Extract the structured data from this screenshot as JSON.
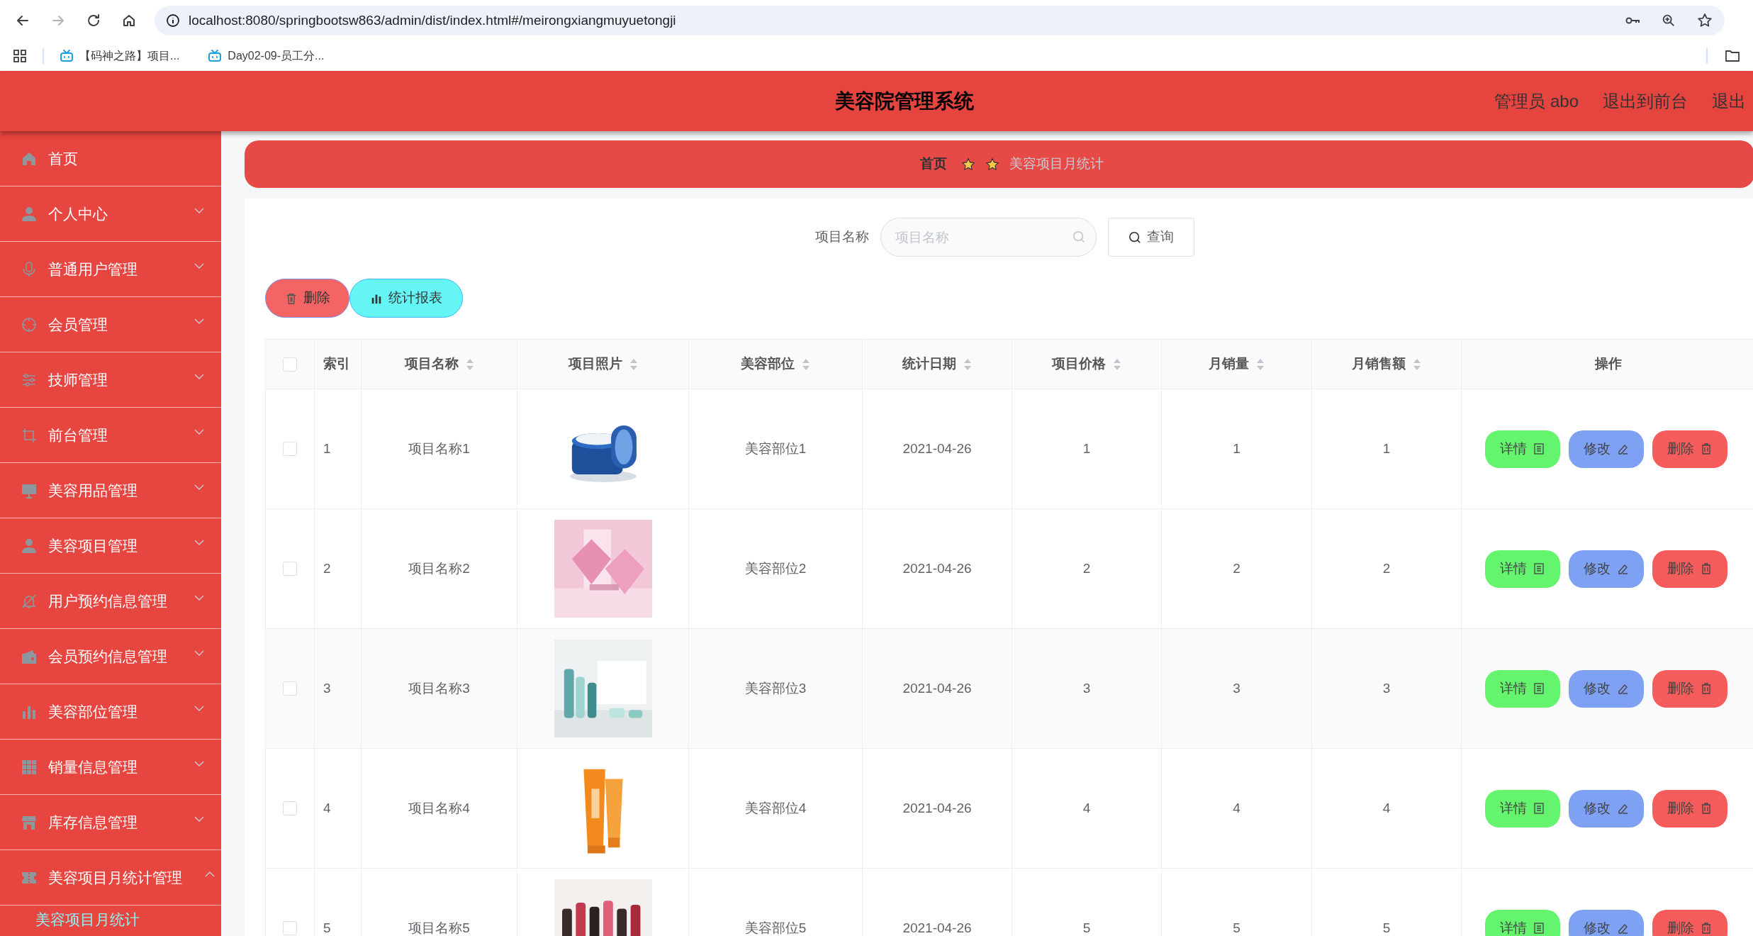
{
  "browser": {
    "url": "localhost:8080/springbootsw863/admin/dist/index.html#/meirongxiangmuyuetongji",
    "nav": [
      {
        "kind": "back",
        "disabled": false
      },
      {
        "kind": "forward",
        "disabled": true
      },
      {
        "kind": "reload",
        "disabled": false
      },
      {
        "kind": "home",
        "disabled": false
      }
    ],
    "bookmarks": [
      "【码神之路】项目...",
      "Day02-09-员工分..."
    ]
  },
  "header": {
    "title": "美容院管理系统",
    "links": [
      "管理员 abo",
      "退出到前台",
      "退出"
    ]
  },
  "sidebar": {
    "items": [
      {
        "label": "首页",
        "kind": "link"
      },
      {
        "label": "个人中心",
        "kind": "menu",
        "expanded": false
      },
      {
        "label": "普通用户管理",
        "kind": "menu",
        "expanded": false
      },
      {
        "label": "会员管理",
        "kind": "menu",
        "expanded": false
      },
      {
        "label": "技师管理",
        "kind": "menu",
        "expanded": false
      },
      {
        "label": "前台管理",
        "kind": "menu",
        "expanded": false
      },
      {
        "label": "美容用品管理",
        "kind": "menu",
        "expanded": false
      },
      {
        "label": "美容项目管理",
        "kind": "menu",
        "expanded": false
      },
      {
        "label": "用户预约信息管理",
        "kind": "menu",
        "expanded": false
      },
      {
        "label": "会员预约信息管理",
        "kind": "menu",
        "expanded": false
      },
      {
        "label": "美容部位管理",
        "kind": "menu",
        "expanded": false
      },
      {
        "label": "销量信息管理",
        "kind": "menu",
        "expanded": false
      },
      {
        "label": "库存信息管理",
        "kind": "menu",
        "expanded": false
      },
      {
        "label": "美容项目月统计管理",
        "kind": "menu",
        "expanded": true,
        "children": [
          {
            "label": "美容项目月统计",
            "selected": true
          }
        ]
      }
    ]
  },
  "breadcrumb": [
    "首页",
    "美容项目月统计"
  ],
  "search": {
    "label": "项目名称",
    "placeholder": "项目名称",
    "button": "查询"
  },
  "actions": [
    {
      "label": "删除",
      "kind": "delete"
    },
    {
      "label": "统计报表",
      "kind": "report"
    }
  ],
  "table": {
    "select_all_checked": false,
    "columns": [
      {
        "label": "索引",
        "sortable": false
      },
      {
        "label": "项目名称",
        "sortable": true
      },
      {
        "label": "项目照片",
        "sortable": true
      },
      {
        "label": "美容部位",
        "sortable": true
      },
      {
        "label": "统计日期",
        "sortable": true
      },
      {
        "label": "项目价格",
        "sortable": true
      },
      {
        "label": "月销量",
        "sortable": true
      },
      {
        "label": "月销售额",
        "sortable": true
      },
      {
        "label": "操作",
        "sortable": false
      }
    ],
    "rows": [
      {
        "checked": false,
        "index": "1",
        "name": "项目名称1",
        "photo": {
          "kind": "picture"
        },
        "part": "美容部位1",
        "date": "2021-04-26",
        "price": "1",
        "sales": "1",
        "revenue": "1",
        "actions": [
          {
            "label": "详情",
            "kind": "detail"
          },
          {
            "label": "修改",
            "kind": "edit"
          },
          {
            "label": "删除",
            "kind": "delete"
          }
        ]
      },
      {
        "checked": false,
        "index": "2",
        "name": "项目名称2",
        "photo": {
          "kind": "picture"
        },
        "part": "美容部位2",
        "date": "2021-04-26",
        "price": "2",
        "sales": "2",
        "revenue": "2",
        "actions": [
          {
            "label": "详情",
            "kind": "detail"
          },
          {
            "label": "修改",
            "kind": "edit"
          },
          {
            "label": "删除",
            "kind": "delete"
          }
        ]
      },
      {
        "checked": false,
        "index": "3",
        "name": "项目名称3",
        "photo": {
          "kind": "picture"
        },
        "part": "美容部位3",
        "date": "2021-04-26",
        "price": "3",
        "sales": "3",
        "revenue": "3",
        "actions": [
          {
            "label": "详情",
            "kind": "detail"
          },
          {
            "label": "修改",
            "kind": "edit"
          },
          {
            "label": "删除",
            "kind": "delete"
          }
        ]
      },
      {
        "checked": false,
        "index": "4",
        "name": "项目名称4",
        "photo": {
          "kind": "picture"
        },
        "part": "美容部位4",
        "date": "2021-04-26",
        "price": "4",
        "sales": "4",
        "revenue": "4",
        "actions": [
          {
            "label": "详情",
            "kind": "detail"
          },
          {
            "label": "修改",
            "kind": "edit"
          },
          {
            "label": "删除",
            "kind": "delete"
          }
        ]
      },
      {
        "checked": false,
        "index": "5",
        "name": "项目名称5",
        "photo": {
          "kind": "picture"
        },
        "part": "美容部位5",
        "date": "2021-04-26",
        "price": "5",
        "sales": "5",
        "revenue": "5",
        "actions": [
          {
            "label": "详情",
            "kind": "detail"
          },
          {
            "label": "修改",
            "kind": "edit"
          },
          {
            "label": "删除",
            "kind": "delete"
          }
        ]
      }
    ]
  }
}
